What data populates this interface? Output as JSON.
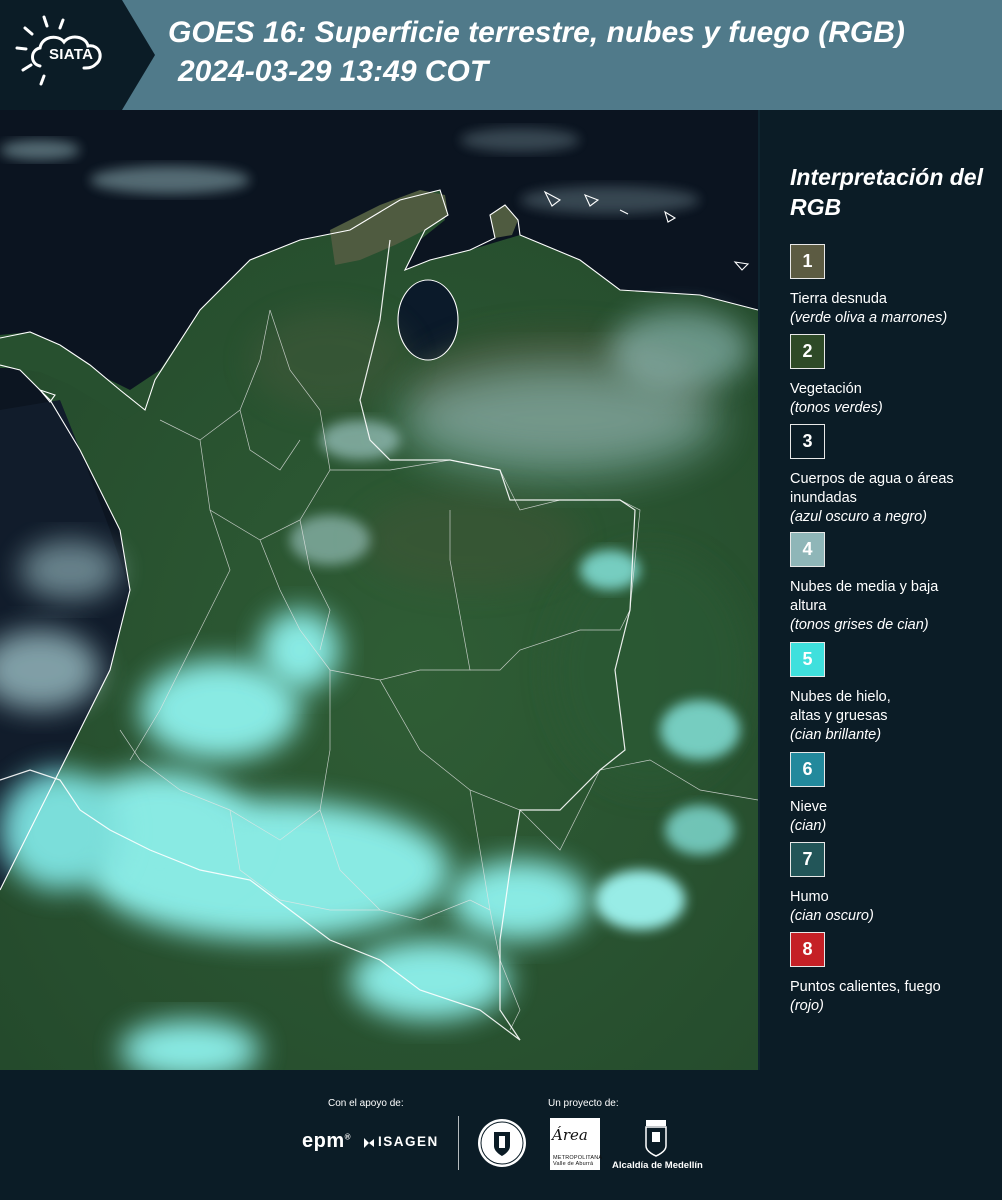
{
  "header": {
    "logo_text": "SIATA",
    "title": "GOES 16: Superficie terrestre, nubes y fuego (RGB)",
    "subtitle": "2024-03-29 13:49 COT"
  },
  "colors": {
    "header_bg": "#507a8a",
    "page_bg": "#0b1c26",
    "map_vegetation": "#2d5a36",
    "map_clouds": "#8cf0ec",
    "map_water": "#0a1422"
  },
  "legend": {
    "title": "Interpretación del RGB",
    "items": [
      {
        "number": "1",
        "color": "#5c5b42",
        "label": "Tierra desnuda",
        "description": "(verde oliva a marrones)"
      },
      {
        "number": "2",
        "color": "#2e4a27",
        "label": "Vegetación",
        "description": "(tonos verdes)"
      },
      {
        "number": "3",
        "color": "#0b1c26",
        "label": "Cuerpos de agua o áreas inundadas",
        "description": "(azul oscuro a negro)"
      },
      {
        "number": "4",
        "color": "#8fb6b8",
        "label": "Nubes de media y baja altura",
        "description": "(tonos grises de cian)"
      },
      {
        "number": "5",
        "color": "#3fe0dd",
        "label": "Nubes de hielo, altas y gruesas",
        "description": "(cian brillante)"
      },
      {
        "number": "6",
        "color": "#23899c",
        "label": "Nieve",
        "description": "(cian)"
      },
      {
        "number": "7",
        "color": "#225558",
        "label": "Humo",
        "description": "(cian oscuro)"
      },
      {
        "number": "8",
        "color": "#c52026",
        "label": "Puntos calientes, fuego",
        "description": "(rojo)"
      }
    ]
  },
  "footer": {
    "support_label": "Con el apoyo de:",
    "project_label": "Un proyecto de:",
    "epm": "epm",
    "isagen": "ISAGEN",
    "area_name": "Área",
    "area_sub": "METROPOLITANA Valle de Aburrá",
    "medellin": "Alcaldía de Medellín"
  }
}
